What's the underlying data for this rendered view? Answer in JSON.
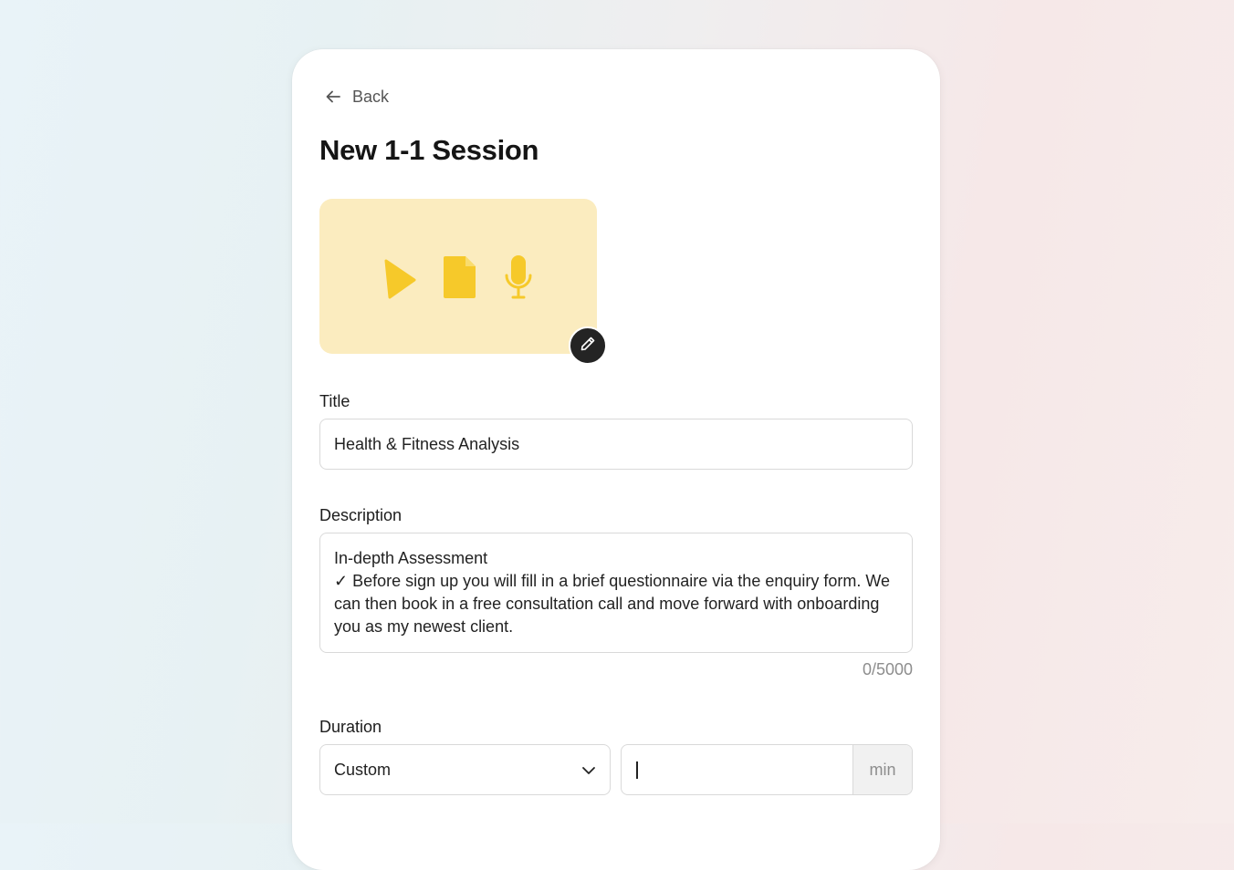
{
  "nav": {
    "back_label": "Back"
  },
  "page": {
    "title": "New 1-1 Session"
  },
  "cover": {
    "background": "#fbecbf",
    "icon_color": "#f6c92a",
    "icons": [
      "play-icon",
      "document-icon",
      "microphone-icon"
    ],
    "edit_icon": "pencil-icon"
  },
  "form": {
    "title_label": "Title",
    "title_value": "Health & Fitness Analysis",
    "description_label": "Description",
    "description_value": "In-depth Assessment\n✓ Before sign up you will fill in a brief questionnaire via the enquiry form. We can then book in a free consultation call and move forward with onboarding you as my newest client.",
    "description_counter": "0/5000",
    "duration_label": "Duration",
    "duration_option": "Custom",
    "duration_minutes": "",
    "duration_unit": "min"
  }
}
